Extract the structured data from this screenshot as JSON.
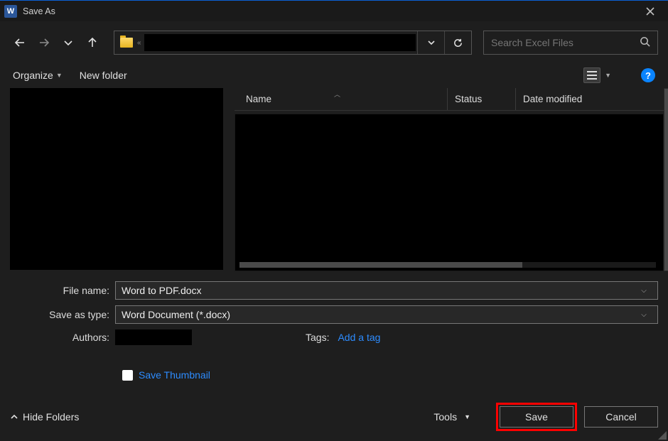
{
  "window": {
    "title": "Save As"
  },
  "search": {
    "placeholder": "Search Excel Files"
  },
  "toolbar": {
    "organize": "Organize",
    "new_folder": "New folder"
  },
  "columns": {
    "name": "Name",
    "status": "Status",
    "date_modified": "Date modified"
  },
  "form": {
    "file_name_label": "File name:",
    "file_name_value": "Word to PDF.docx",
    "save_type_label": "Save as type:",
    "save_type_value": "Word Document (*.docx)",
    "authors_label": "Authors:",
    "tags_label": "Tags:",
    "tags_link": "Add a tag",
    "save_thumbnail": "Save Thumbnail"
  },
  "footer": {
    "hide_folders": "Hide Folders",
    "tools": "Tools",
    "save": "Save",
    "cancel": "Cancel"
  }
}
